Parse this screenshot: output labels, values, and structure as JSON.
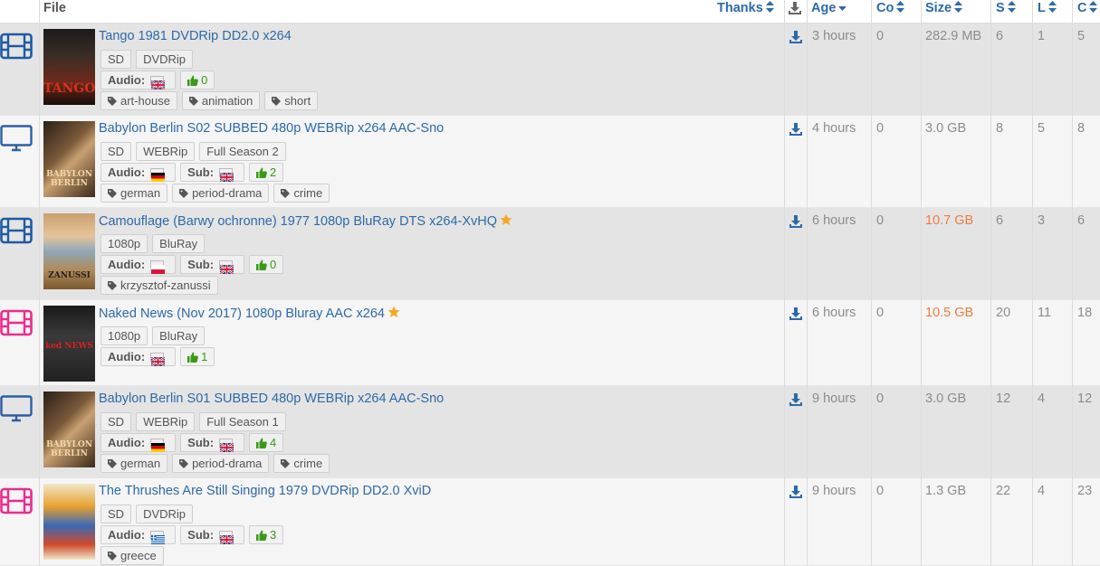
{
  "header": {
    "file": "File",
    "thanks": "Thanks",
    "age": "Age",
    "comments": "Co",
    "size": "Size",
    "seeders": "S",
    "leechers": "L",
    "completed": "C"
  },
  "labels": {
    "audio": "Audio:",
    "sub": "Sub:"
  },
  "colors": {
    "link": "#2c6aa8",
    "movie_icon": "#1f5aa0",
    "adult_icon": "#ee2a8c",
    "tv_icon": "#2a5fa4",
    "likes": "#3a9a18",
    "big_size": "#f07c3c"
  },
  "rows": [
    {
      "category_icon": "film-icon",
      "poster_text": "TANGO",
      "title": "Tango 1981 DVDRip DD2.0 x264",
      "starred": false,
      "badges": [
        "SD",
        "DVDRip"
      ],
      "audio_flag": "uk-flag",
      "sub_flag": null,
      "likes": "0",
      "tags": [
        "art-house",
        "animation",
        "short"
      ],
      "age": "3 hours",
      "comments": "0",
      "size": "282.9 MB",
      "size_big": false,
      "seeders": "6",
      "leechers": "1",
      "completed": "5"
    },
    {
      "category_icon": "monitor-icon",
      "poster_text": "BABYLON BERLIN",
      "title": "Babylon Berlin S02 SUBBED 480p WEBRip x264 AAC-Sno",
      "starred": false,
      "badges": [
        "SD",
        "WEBRip",
        "Full Season 2"
      ],
      "audio_flag": "de-flag",
      "sub_flag": "uk-flag",
      "likes": "2",
      "tags": [
        "german",
        "period-drama",
        "crime"
      ],
      "age": "4 hours",
      "comments": "0",
      "size": "3.0 GB",
      "size_big": false,
      "seeders": "8",
      "leechers": "5",
      "completed": "8"
    },
    {
      "category_icon": "film-icon",
      "poster_text": "ZANUSSI",
      "title": "Camouflage (Barwy ochronne) 1977 1080p BluRay DTS x264-XvHQ",
      "starred": true,
      "badges": [
        "1080p",
        "BluRay"
      ],
      "audio_flag": "pl-flag",
      "sub_flag": "uk-flag",
      "likes": "0",
      "tags": [
        "krzysztof-zanussi"
      ],
      "age": "6 hours",
      "comments": "0",
      "size": "10.7 GB",
      "size_big": true,
      "seeders": "6",
      "leechers": "3",
      "completed": "6"
    },
    {
      "category_icon": "film-adult-icon",
      "poster_text": "ked NEWS",
      "title": "Naked News (Nov 2017) 1080p Bluray AAC x264",
      "starred": true,
      "badges": [
        "1080p",
        "BluRay"
      ],
      "audio_flag": "uk-flag",
      "sub_flag": null,
      "likes": "1",
      "tags": [],
      "age": "6 hours",
      "comments": "0",
      "size": "10.5 GB",
      "size_big": true,
      "seeders": "20",
      "leechers": "11",
      "completed": "18"
    },
    {
      "category_icon": "monitor-icon",
      "poster_text": "BABYLON BERLIN",
      "title": "Babylon Berlin S01 SUBBED 480p WEBRip x264 AAC-Sno",
      "starred": false,
      "badges": [
        "SD",
        "WEBRip",
        "Full Season 1"
      ],
      "audio_flag": "de-flag",
      "sub_flag": "uk-flag",
      "likes": "4",
      "tags": [
        "german",
        "period-drama",
        "crime"
      ],
      "age": "9 hours",
      "comments": "0",
      "size": "3.0 GB",
      "size_big": false,
      "seeders": "12",
      "leechers": "4",
      "completed": "12"
    },
    {
      "category_icon": "film-adult-icon",
      "poster_text": "",
      "title": "The Thrushes Are Still Singing 1979 DVDRip DD2.0 XviD",
      "starred": false,
      "badges": [
        "SD",
        "DVDRip"
      ],
      "audio_flag": "gr-flag",
      "sub_flag": "uk-flag",
      "likes": "3",
      "tags": [
        "greece"
      ],
      "age": "9 hours",
      "comments": "0",
      "size": "1.3 GB",
      "size_big": false,
      "seeders": "22",
      "leechers": "4",
      "completed": "23"
    }
  ]
}
